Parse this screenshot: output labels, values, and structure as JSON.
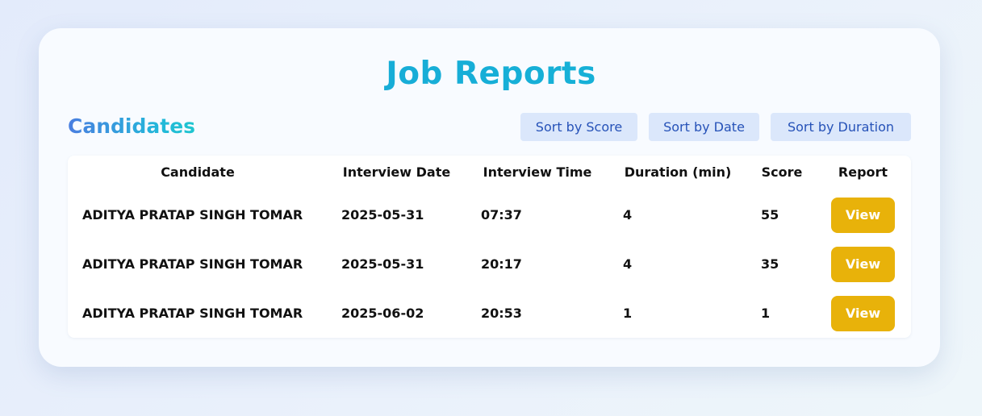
{
  "page": {
    "title": "Job Reports",
    "subtitle": "Candidates"
  },
  "sort_buttons": {
    "score": "Sort by Score",
    "date": "Sort by Date",
    "duration": "Sort by Duration"
  },
  "table": {
    "headers": [
      "Candidate",
      "Interview Date",
      "Interview Time",
      "Duration (min)",
      "Score",
      "Report"
    ],
    "rows": [
      {
        "candidate": "ADITYA PRATAP SINGH TOMAR",
        "date": "2025-05-31",
        "time": "07:37",
        "duration": "4",
        "score": "55",
        "report": "View"
      },
      {
        "candidate": "ADITYA PRATAP SINGH TOMAR",
        "date": "2025-05-31",
        "time": "20:17",
        "duration": "4",
        "score": "35",
        "report": "View"
      },
      {
        "candidate": "ADITYA PRATAP SINGH TOMAR",
        "date": "2025-06-02",
        "time": "20:53",
        "duration": "1",
        "score": "1",
        "report": "View"
      }
    ]
  },
  "colors": {
    "title_gradient": [
      "#1aa6d8",
      "#13b7d6"
    ],
    "subtitle_gradient": [
      "#4a7ee0",
      "#1fc6cf"
    ],
    "sort_button_bg": "#dbe7fb",
    "sort_button_text": "#2652b8",
    "view_button_bg": "#e8b20a"
  }
}
